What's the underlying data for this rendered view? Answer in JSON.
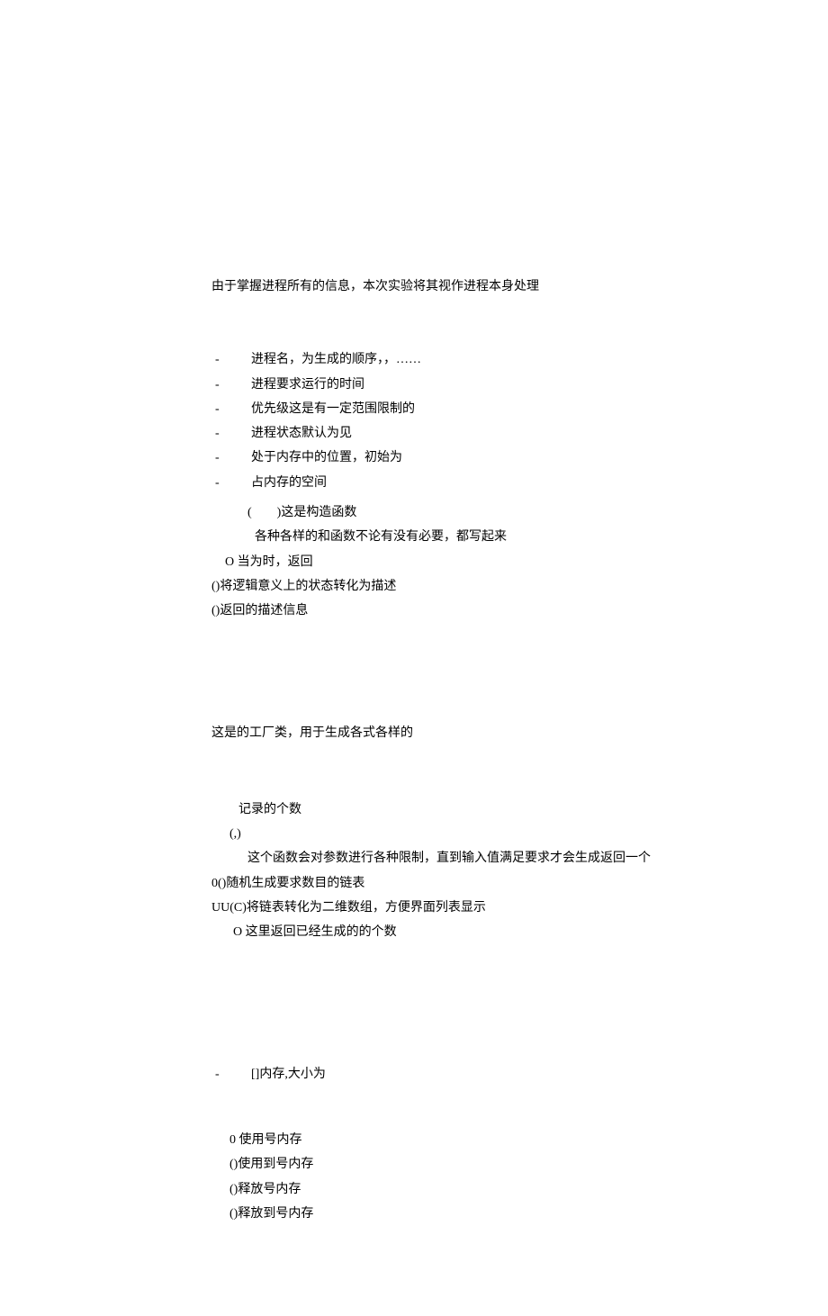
{
  "section1": {
    "intro": "由于掌握进程所有的信息，本次实验将其视作进程本身处理",
    "items": [
      "进程名，为生成的顺序，，……",
      "进程要求运行的时间",
      "优先级这是有一定范围限制的",
      "进程状态默认为见",
      "处于内存中的位置，初始为",
      "占内存的空间"
    ],
    "sub1": "(  )这是构造函数",
    "sub2": "各种各样的和函数不论有没有必要，都写起来",
    "sub3": "O 当为时，返回",
    "sub4": "()将逻辑意义上的状态转化为描述",
    "sub5": "()返回的描述信息"
  },
  "section2": {
    "intro": "这是的工厂类，用于生成各式各样的",
    "line1": "记录的个数",
    "line2": "(,)",
    "line3": "这个函数会对参数进行各种限制，直到输入值满足要求才会生成返回一个",
    "line4": "0()随机生成要求数目的链表",
    "line5": "UU(C)将链表转化为二维数组，方便界面列表显示",
    "line6": "O 这里返回已经生成的的个数"
  },
  "section3": {
    "item1": "[]内存,大小为",
    "line1": "0 使用号内存",
    "line2": "()使用到号内存",
    "line3": "()释放号内存",
    "line4": "()释放到号内存"
  }
}
